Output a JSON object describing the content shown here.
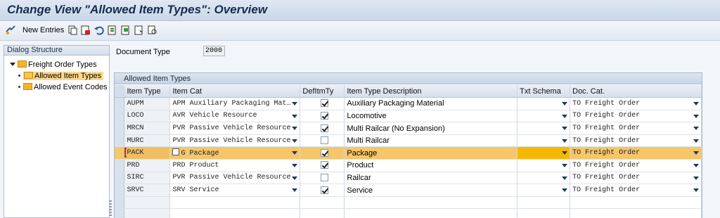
{
  "title": "Change View \"Allowed Item Types\": Overview",
  "toolbar": {
    "new_entries_label": "New Entries"
  },
  "dialog_structure": {
    "header": "Dialog Structure",
    "root": "Freight Order Types",
    "children": [
      "Allowed Item Types",
      "Allowed Event Codes"
    ],
    "selected": "Allowed Item Types"
  },
  "document_type": {
    "label": "Document Type",
    "value": "2000"
  },
  "panel": {
    "title": "Allowed Item Types"
  },
  "columns": [
    "Item Type",
    "Item Cat",
    "DefItmTy",
    "Item Type Description",
    "Txt Schema",
    "Doc. Cat."
  ],
  "rows": [
    {
      "item_type": "AUPM",
      "item_cat": "APM Auxiliary Packaging Mat…",
      "def": true,
      "desc": "Auxiliary Packaging Material",
      "txt_schema": "",
      "doc_cat": "TO Freight Order"
    },
    {
      "item_type": "LOCO",
      "item_cat": "AVR Vehicle Resource",
      "def": true,
      "desc": "Locomotive",
      "txt_schema": "",
      "doc_cat": "TO Freight Order"
    },
    {
      "item_type": "MRCN",
      "item_cat": "PVR Passive Vehicle Resource",
      "def": true,
      "desc": "Multi Railcar (No Expansion)",
      "txt_schema": "",
      "doc_cat": "TO Freight Order"
    },
    {
      "item_type": "MURC",
      "item_cat": "PVR Passive Vehicle Resource",
      "def": false,
      "desc": "Multi Railcar",
      "txt_schema": "",
      "doc_cat": "TO Freight Order"
    },
    {
      "item_type": "PACK",
      "item_cat": "G Package",
      "def": true,
      "desc": "Package",
      "txt_schema": "",
      "doc_cat": "TO Freight Order"
    },
    {
      "item_type": "PRD",
      "item_cat": "PRD Product",
      "def": true,
      "desc": "Product",
      "txt_schema": "",
      "doc_cat": "TO Freight Order"
    },
    {
      "item_type": "SIRC",
      "item_cat": "PVR Passive Vehicle Resource",
      "def": false,
      "desc": "Railcar",
      "txt_schema": "",
      "doc_cat": "TO Freight Order"
    },
    {
      "item_type": "SRVC",
      "item_cat": "SRV Service",
      "def": true,
      "desc": "Service",
      "txt_schema": "",
      "doc_cat": "TO Freight Order"
    }
  ],
  "highlighted_row": 4,
  "colors": {
    "highlight": "#f5c66a",
    "txt_schema_highlight": "#f5b800",
    "title": "#152c4c"
  }
}
